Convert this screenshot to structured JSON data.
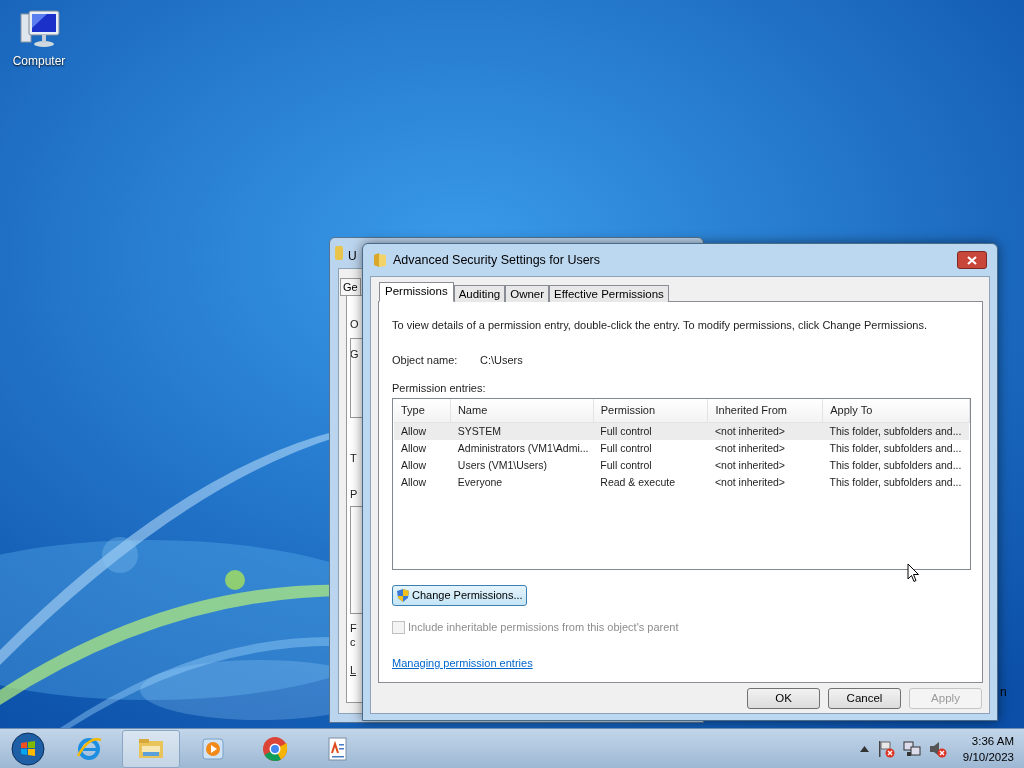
{
  "desktop_icons": [
    {
      "label": "Computer"
    }
  ],
  "back_window": {
    "title": "U",
    "tab": "Ge",
    "fragments": [
      "O",
      "G",
      "T",
      "P",
      "F",
      "c",
      "L"
    ]
  },
  "stray_text": "n",
  "dialog": {
    "title": "Advanced Security Settings for Users",
    "tabs": [
      {
        "label": "Permissions",
        "selected": true
      },
      {
        "label": "Auditing",
        "selected": false
      },
      {
        "label": "Owner",
        "selected": false
      },
      {
        "label": "Effective Permissions",
        "selected": false
      }
    ],
    "instructions": "To view details of a permission entry, double-click the entry. To modify permissions, click Change Permissions.",
    "object_name_label": "Object name:",
    "object_name": "C:\\Users",
    "entries_label": "Permission entries:",
    "table": {
      "columns": [
        "Type",
        "Name",
        "Permission",
        "Inherited From",
        "Apply To"
      ],
      "rows": [
        {
          "cells": [
            "Allow",
            "SYSTEM",
            "Full control",
            "<not inherited>",
            "This folder, subfolders and..."
          ],
          "selected": true
        },
        {
          "cells": [
            "Allow",
            "Administrators (VM1\\Admi...",
            "Full control",
            "<not inherited>",
            "This folder, subfolders and..."
          ],
          "selected": false
        },
        {
          "cells": [
            "Allow",
            "Users (VM1\\Users)",
            "Full control",
            "<not inherited>",
            "This folder, subfolders and..."
          ],
          "selected": false
        },
        {
          "cells": [
            "Allow",
            "Everyone",
            "Read & execute",
            "<not inherited>",
            "This folder, subfolders and..."
          ],
          "selected": false
        }
      ]
    },
    "change_button": "Change Permissions...",
    "inherit_checkbox": {
      "label": "Include inheritable permissions from this object's parent",
      "checked": false,
      "disabled": true
    },
    "help_link": "Managing permission entries",
    "buttons": [
      {
        "label": "OK",
        "disabled": false
      },
      {
        "label": "Cancel",
        "disabled": false
      },
      {
        "label": "Apply",
        "disabled": true
      }
    ]
  },
  "taskbar": {
    "apps": [
      {
        "kind": "ie",
        "active": false
      },
      {
        "kind": "explorer",
        "active": true
      },
      {
        "kind": "media",
        "active": false
      },
      {
        "kind": "chrome",
        "active": false
      },
      {
        "kind": "wordpad",
        "active": false
      }
    ],
    "time": "3:36 AM",
    "date": "9/10/2023"
  }
}
